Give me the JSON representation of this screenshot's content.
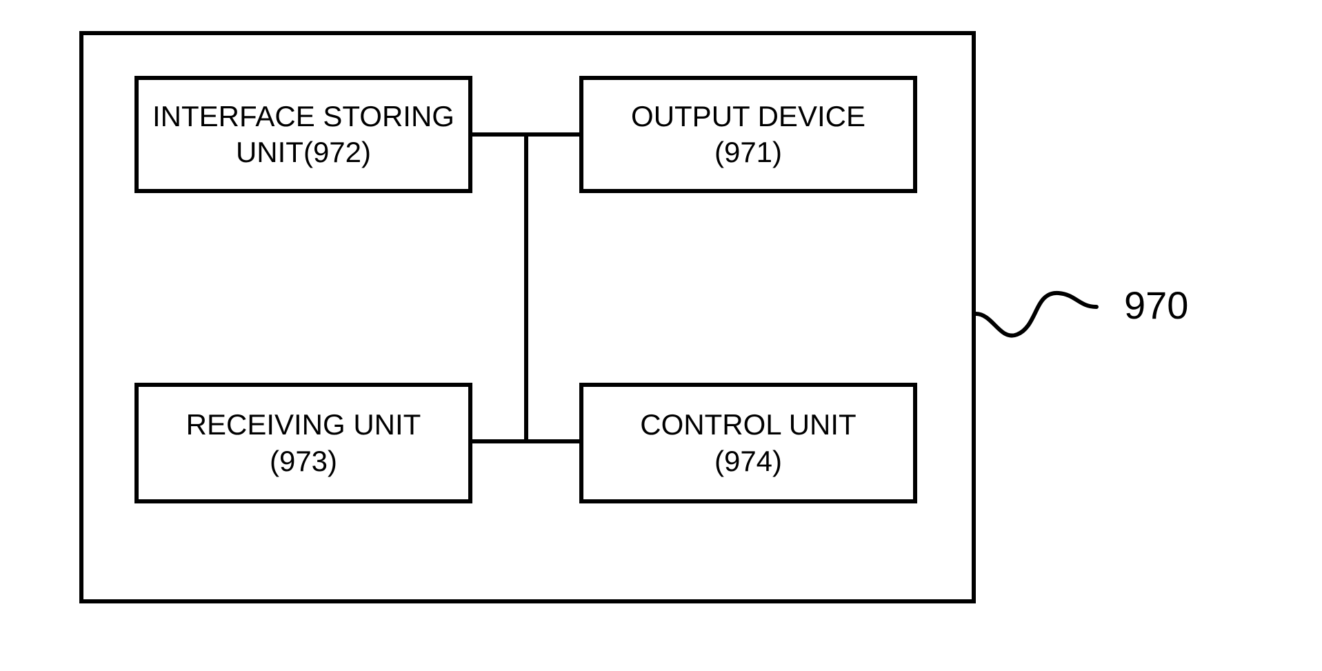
{
  "diagram": {
    "ref": "970",
    "blocks": {
      "tl": {
        "line1": "INTERFACE STORING",
        "line2": "UNIT(972)"
      },
      "tr": {
        "line1": "OUTPUT DEVICE",
        "line2": "(971)"
      },
      "bl": {
        "line1": "RECEIVING UNIT",
        "line2": "(973)"
      },
      "br": {
        "line1": "CONTROL UNIT",
        "line2": "(974)"
      }
    }
  }
}
